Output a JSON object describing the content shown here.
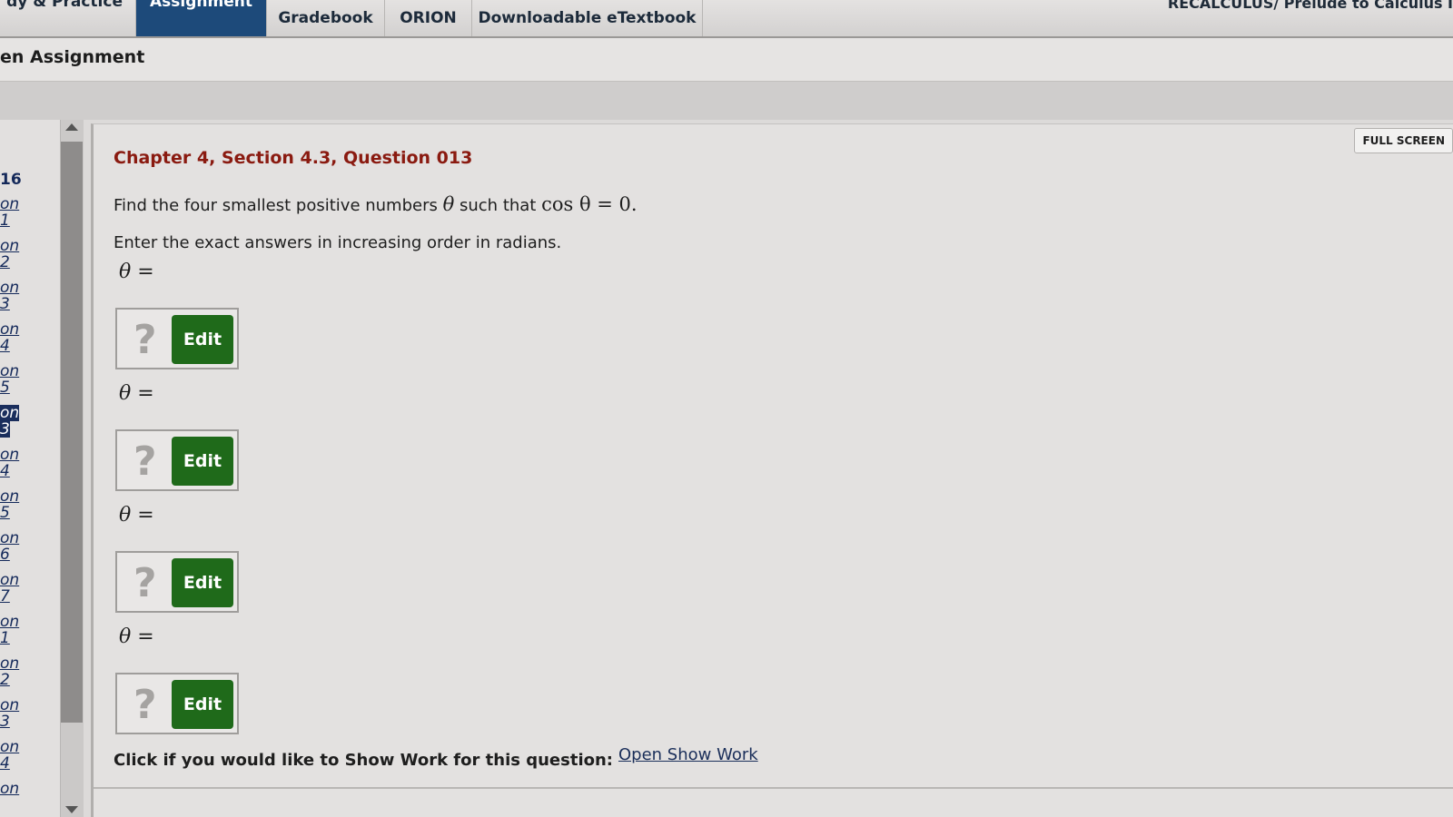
{
  "topnav": {
    "tabs": [
      {
        "label": "dy & Practice"
      },
      {
        "label": "Assignment"
      },
      {
        "label": "Gradebook"
      },
      {
        "label": "ORION"
      },
      {
        "label": "Downloadable eTextbook"
      }
    ],
    "course_title": "RECALCULUS/ Prelude to Calculus I"
  },
  "breadcrumb": {
    "title": "en Assignment"
  },
  "sidebar": {
    "header": "16",
    "items": [
      {
        "l1": "on",
        "l2": "1"
      },
      {
        "l1": "on",
        "l2": "2"
      },
      {
        "l1": "on",
        "l2": "3"
      },
      {
        "l1": "on",
        "l2": "4"
      },
      {
        "l1": "on",
        "l2": "5"
      },
      {
        "l1": "on",
        "l2": "3"
      },
      {
        "l1": "on",
        "l2": "4"
      },
      {
        "l1": "on",
        "l2": "5"
      },
      {
        "l1": "on",
        "l2": "6"
      },
      {
        "l1": "on",
        "l2": "7"
      },
      {
        "l1": "on",
        "l2": "1"
      },
      {
        "l1": "on",
        "l2": "2"
      },
      {
        "l1": "on",
        "l2": "3"
      },
      {
        "l1": "on",
        "l2": "4"
      },
      {
        "l1": "on",
        "l2": ""
      }
    ],
    "current_index": 5
  },
  "question": {
    "fullscreen_label": "FULL SCREEN",
    "title": "Chapter 4, Section 4.3, Question 013",
    "prompt_before": "Find the four smallest positive numbers",
    "prompt_theta": "θ",
    "prompt_mid": "such that",
    "prompt_equation": "cos θ = 0.",
    "instructions": "Enter the exact answers in increasing order in radians.",
    "answers": [
      {
        "label": "θ =",
        "placeholder": "?",
        "edit_label": "Edit"
      },
      {
        "label": "θ =",
        "placeholder": "?",
        "edit_label": "Edit"
      },
      {
        "label": "θ =",
        "placeholder": "?",
        "edit_label": "Edit"
      },
      {
        "label": "θ =",
        "placeholder": "?",
        "edit_label": "Edit"
      }
    ],
    "showwork_prompt": "Click if you would like to Show Work for this question:",
    "showwork_link": "Open Show Work"
  }
}
